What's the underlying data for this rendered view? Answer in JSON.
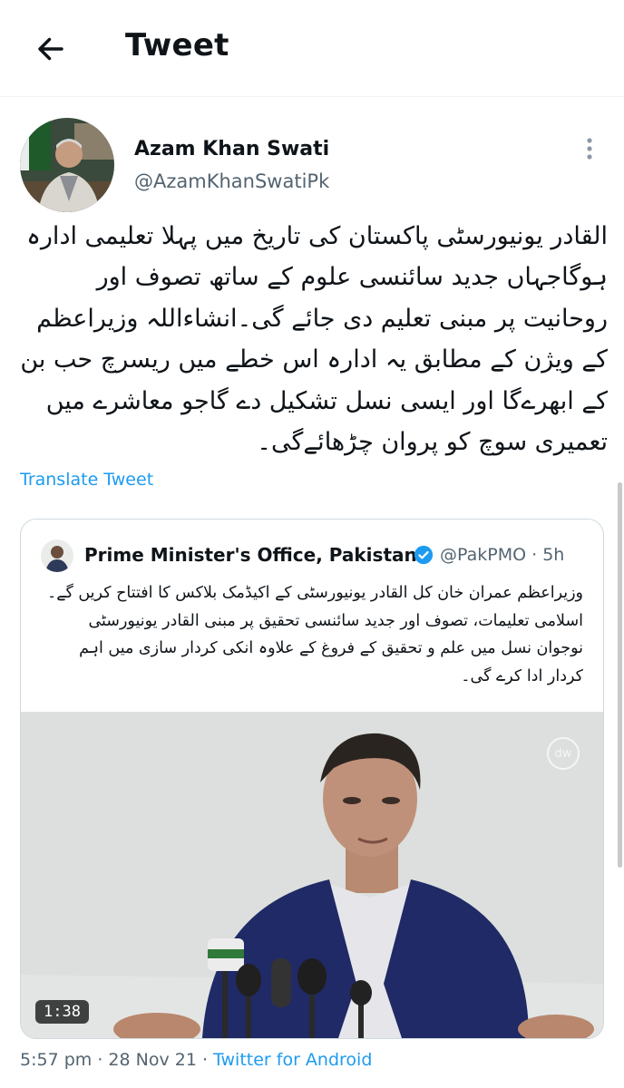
{
  "header": {
    "title": "Tweet",
    "back_icon": "arrow-left-icon"
  },
  "tweet": {
    "author_name": "Azam Khan Swati",
    "author_handle": "@AzamKhanSwatiPk",
    "more_icon": "more-vertical-icon",
    "text": "القادر یونیورسٹی پاکستان کی تاریخ میں پہلا تعلیمی ادارہ ہوگاجہاں جدید سائنسی علوم کے ساتھ تصوف اور روحانیت پر مبنی تعلیم دی جائے گی۔انشاءاللہ وزیراعظم کے ویژن کے مطابق یہ ادارہ اس خطے میں ریسرچ حب بن کے ابھرےگا اور ایسی نسل تشکیل دے گاجو معاشرے میں تعمیری سوچ کو پروان چڑھائےگی۔",
    "translate_label": "Translate Tweet",
    "time": "5:57 pm",
    "date": "28 Nov 21",
    "source": "Twitter for Android",
    "link_color": "#1d9bf0"
  },
  "quoted": {
    "name": "Prime Minister's Office, Pakistan",
    "verified_icon": "verified-badge-icon",
    "handle": "@PakPMO",
    "age": "5h",
    "text": "وزیراعظم عمران خان کل القادر یونیورسٹی کے اکیڈمک بلاکس کا افتتاح کریں گے۔ اسلامی تعلیمات، تصوف اور جدید سائنسی تحقیق پر مبنی القادر یونیورسٹی نوجوان نسل میں علم و تحقیق کے فروغ کے علاوہ انکی کردار سازی میں اہم کردار ادا کرے گی۔",
    "video_duration": "1:38",
    "watermark": "dw"
  }
}
